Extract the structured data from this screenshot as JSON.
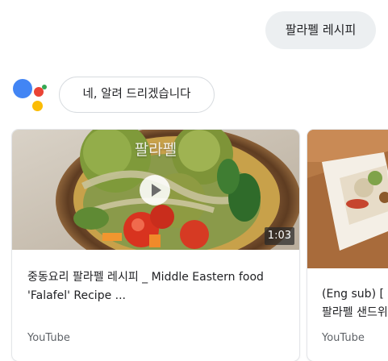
{
  "conversation": {
    "user_query": "팔라펠 레시피",
    "assistant_reply": "네, 알려 드리겠습니다"
  },
  "assistant_logo": {
    "colors": {
      "blue": "#4285f4",
      "red": "#ea4335",
      "yellow": "#fbbc05",
      "green": "#34a853"
    }
  },
  "results": [
    {
      "thumbnail_caption": "팔라펠",
      "duration": "1:03",
      "title_line1": "중동요리 팔라펠 레시피 _ Middle Eastern food",
      "title_line2": "'Falafel' Recipe ...",
      "source": "YouTube"
    },
    {
      "title_line1": "(Eng sub) [",
      "title_line2": "팔라펠 샌드위",
      "source": "YouTube"
    }
  ]
}
